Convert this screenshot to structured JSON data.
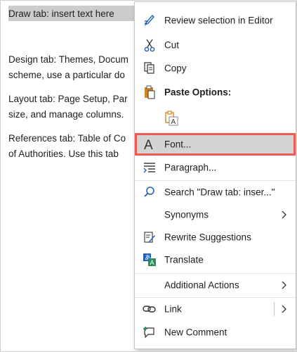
{
  "document": {
    "selected_text": "Draw tab: insert text here",
    "lines": [
      "Design tab: Themes, Docum",
      "scheme, use a particular do",
      "Layout tab: Page Setup, Par",
      "size, and manage columns.",
      "References tab: Table of Co",
      "of Authorities. Use this tab"
    ]
  },
  "menu": {
    "review": "Review selection in Editor",
    "cut": "Cut",
    "copy": "Copy",
    "paste_options": "Paste Options:",
    "font": "Font...",
    "paragraph": "Paragraph...",
    "search": "Search \"Draw tab: inser...\"",
    "synonyms": "Synonyms",
    "rewrite": "Rewrite Suggestions",
    "translate": "Translate",
    "additional": "Additional Actions",
    "link": "Link",
    "new_comment": "New Comment"
  },
  "colors": {
    "highlight_border": "#ef5a54",
    "hover_bg": "#d4d4d4",
    "selection_bg": "#cccccc",
    "icon_blue": "#1e5fb4",
    "icon_orange": "#d8831a",
    "icon_green": "#2e8b57"
  }
}
